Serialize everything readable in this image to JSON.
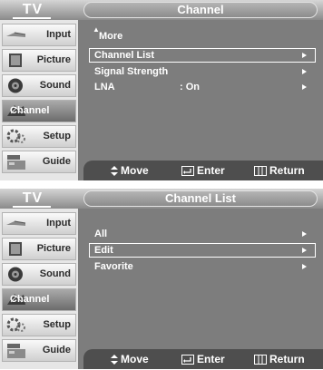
{
  "screens": [
    {
      "tv_label": "TV",
      "title": "Channel",
      "sidebar": [
        {
          "label": "Input",
          "icon": "input-icon",
          "active": false
        },
        {
          "label": "Picture",
          "icon": "picture-icon",
          "active": false
        },
        {
          "label": "Sound",
          "icon": "sound-icon",
          "active": false
        },
        {
          "label": "Channel",
          "icon": "channel-icon",
          "active": true
        },
        {
          "label": "Setup",
          "icon": "setup-icon",
          "active": false
        },
        {
          "label": "Guide",
          "icon": "guide-icon",
          "active": false
        }
      ],
      "more_label": "More",
      "menu": [
        {
          "label": "Channel List",
          "value": "",
          "selected": true
        },
        {
          "label": "Signal Strength",
          "value": "",
          "selected": false
        },
        {
          "label": "LNA",
          "value": ": On",
          "selected": false
        }
      ],
      "footer": {
        "move": "Move",
        "enter": "Enter",
        "return": "Return"
      }
    },
    {
      "tv_label": "TV",
      "title": "Channel List",
      "sidebar": [
        {
          "label": "Input",
          "icon": "input-icon",
          "active": false
        },
        {
          "label": "Picture",
          "icon": "picture-icon",
          "active": false
        },
        {
          "label": "Sound",
          "icon": "sound-icon",
          "active": false
        },
        {
          "label": "Channel",
          "icon": "channel-icon",
          "active": true
        },
        {
          "label": "Setup",
          "icon": "setup-icon",
          "active": false
        },
        {
          "label": "Guide",
          "icon": "guide-icon",
          "active": false
        }
      ],
      "menu": [
        {
          "label": "All",
          "value": "",
          "selected": false
        },
        {
          "label": "Edit",
          "value": "",
          "selected": true
        },
        {
          "label": "Favorite",
          "value": "",
          "selected": false
        }
      ],
      "footer": {
        "move": "Move",
        "enter": "Enter",
        "return": "Return"
      }
    }
  ],
  "colors": {
    "screen_bg": "#7d7d7d",
    "sidebar_bg": "#e6e6e6",
    "footer_bg": "#4e4e4e",
    "text": "#ffffff"
  }
}
